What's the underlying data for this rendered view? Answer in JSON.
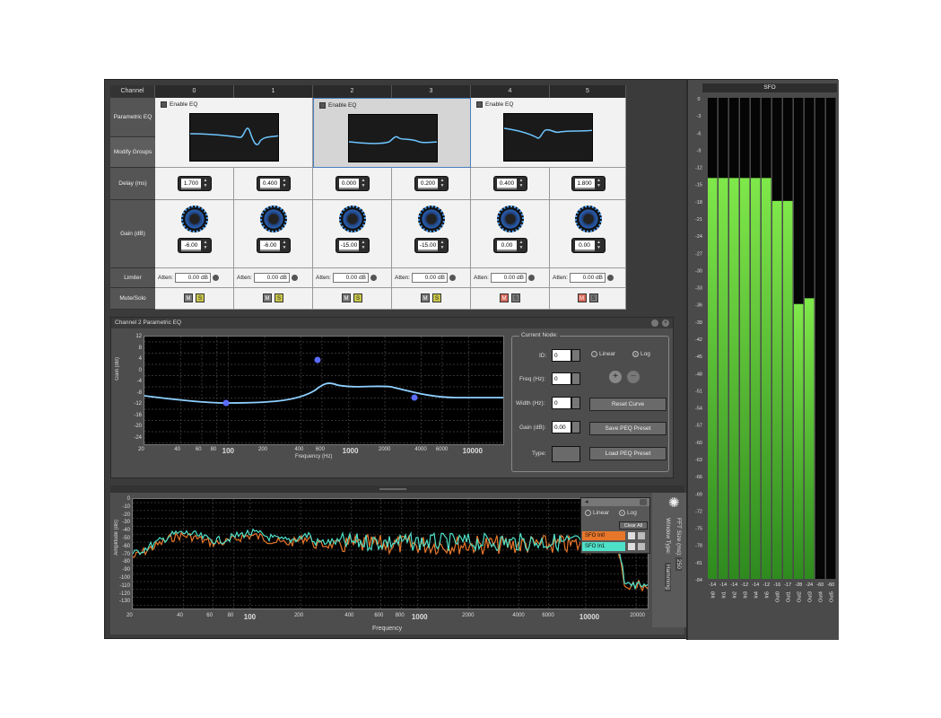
{
  "matrix": {
    "channel_header": "Channel",
    "channels": [
      "0",
      "1",
      "2",
      "3",
      "4",
      "5"
    ],
    "row_labels": {
      "peq": "Parametric EQ",
      "modify_groups": "Modify Groups",
      "delay": "Delay (ms)",
      "gain": "Gain (dB)",
      "limiter": "Limiter",
      "mute_solo": "Mute/Solo"
    },
    "enable_eq_label": "Enable EQ",
    "delays": [
      "1.700",
      "0.400",
      "0.000",
      "0.200",
      "0.400",
      "1.800"
    ],
    "gains": [
      "-6.00",
      "-6.00",
      "-15.00",
      "-15.00",
      "0.00",
      "0.00"
    ],
    "atten_label": "Atten:",
    "atten_values": [
      "0.00 dB",
      "0.00 dB",
      "0.00 dB",
      "0.00 dB",
      "0.00 dB",
      "0.00 dB"
    ],
    "mute_label": "M",
    "solo_label": "S"
  },
  "peq": {
    "title": "Channel 2 Parametric EQ",
    "y_axis_label": "Gain (dB)",
    "x_axis_label": "Frequency (Hz)",
    "y_ticks": [
      "12",
      "8",
      "4",
      "0",
      "-4",
      "-8",
      "-12",
      "-16",
      "-20",
      "-24"
    ],
    "x_ticks": [
      "20",
      "40",
      "60",
      "80",
      "100",
      "200",
      "400",
      "600",
      "1000",
      "2000",
      "4000",
      "6000",
      "10000"
    ],
    "current_node": {
      "title": "Current Node:",
      "id_label": "ID:",
      "id_value": "0",
      "freq_label": "Freq (Hz):",
      "freq_value": "0",
      "width_label": "Width (Hz):",
      "width_value": "0",
      "gain_label": "Gain (dB):",
      "gain_value": "0.00",
      "type_label": "Type:",
      "linear_label": "Linear",
      "log_label": "Log",
      "reset_button": "Reset Curve",
      "save_button": "Save PEQ Preset",
      "load_button": "Load PEQ Preset"
    }
  },
  "spectrum": {
    "y_axis_label": "Amplitude (dB)",
    "x_axis_label": "Frequency",
    "y_ticks": [
      "0",
      "-10",
      "-20",
      "-30",
      "-40",
      "-50",
      "-60",
      "-70",
      "-80",
      "-90",
      "-100",
      "-110",
      "-120",
      "-130"
    ],
    "x_ticks": [
      "20",
      "40",
      "60",
      "80",
      "100",
      "200",
      "400",
      "600",
      "800",
      "1000",
      "2000",
      "4000",
      "6000",
      "10000",
      "20000"
    ],
    "linear_label": "Linear",
    "log_label": "Log",
    "clear_all": "Clear All",
    "traces": [
      "SFO In0",
      "SFO In1"
    ],
    "trace_colors": [
      "#e8762a",
      "#4fe0c8"
    ],
    "fft_size_label": "FFT Size (ms):",
    "fft_size_value": "250",
    "window_type_label": "Window Type:",
    "window_type_value": "Hamming"
  },
  "meters": {
    "title": "SFO",
    "scale": [
      "0",
      "-3",
      "-6",
      "-9",
      "-12",
      "-15",
      "-18",
      "-21",
      "-24",
      "-27",
      "-30",
      "-33",
      "-36",
      "-39",
      "-42",
      "-45",
      "-48",
      "-51",
      "-54",
      "-57",
      "-60",
      "-63",
      "-66",
      "-69",
      "-72",
      "-75",
      "-78",
      "-81",
      "-84"
    ],
    "readouts": [
      "-14",
      "-14",
      "-14",
      "-12",
      "-14",
      "-12",
      "-16",
      "-17",
      "-28",
      "-24",
      "-60",
      "-60"
    ],
    "names": [
      "In0",
      "In1",
      "In2",
      "In3",
      "In4",
      "In5",
      "Out0",
      "Out1",
      "Out2",
      "Out3",
      "Out4",
      "Out5"
    ],
    "levels_db": [
      -14,
      -14,
      -14,
      -14,
      -14,
      -14,
      -18,
      -18,
      -36,
      -35,
      -90,
      -90
    ]
  }
}
